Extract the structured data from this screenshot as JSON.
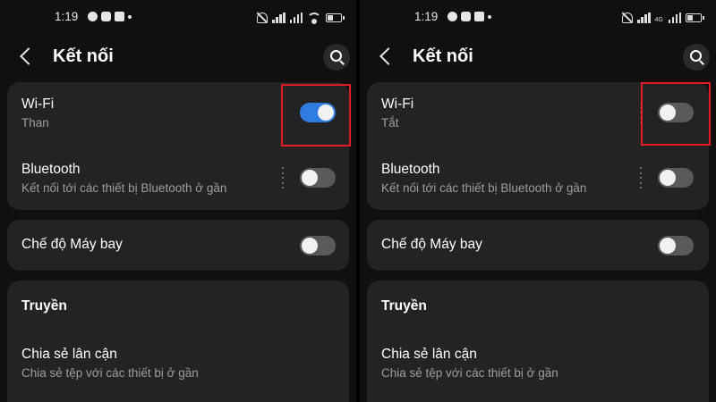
{
  "screens": {
    "left": {
      "status": {
        "time": "1:19",
        "network_tag": ""
      },
      "app_bar": {
        "title": "Kết nối",
        "back_icon": "chevron-left-icon",
        "search_icon": "search-icon"
      },
      "wifi": {
        "label": "Wi-Fi",
        "status": "Than",
        "enabled": true
      },
      "bluetooth": {
        "label": "Bluetooth",
        "status": "Kết nối tới các thiết bị Bluetooth ở gần",
        "enabled": false
      },
      "airplane_mode": {
        "label": "Chế độ Máy bay",
        "enabled": false
      },
      "section_header": "Truyền",
      "nearby_share": {
        "label": "Chia sẻ lân cận",
        "status": "Chia sẻ tệp với các thiết bị ở gần"
      }
    },
    "right": {
      "status": {
        "time": "1:19",
        "network_tag": "4G"
      },
      "app_bar": {
        "title": "Kết nối",
        "back_icon": "chevron-left-icon",
        "search_icon": "search-icon"
      },
      "wifi": {
        "label": "Wi-Fi",
        "status": "Tắt",
        "enabled": false
      },
      "bluetooth": {
        "label": "Bluetooth",
        "status": "Kết nối tới các thiết bị Bluetooth ở gần",
        "enabled": false
      },
      "airplane_mode": {
        "label": "Chế độ Máy bay",
        "enabled": false
      },
      "section_header": "Truyền",
      "nearby_share": {
        "label": "Chia sẻ lân cận",
        "status": "Chia sẻ tệp với các thiết bị ở gần"
      }
    }
  },
  "colors": {
    "background": "#101010",
    "card": "#232323",
    "toggle_on": "#2f7de0",
    "toggle_off": "#5a5a5a",
    "secondary_text": "#9e9e9e",
    "highlight": "#e21c2a"
  }
}
